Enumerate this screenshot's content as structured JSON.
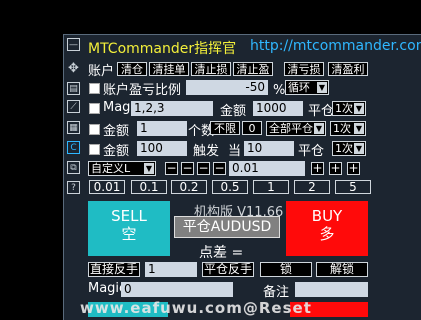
{
  "header": {
    "title": "MTCommander指挥官",
    "url": "http://mtcommander.com"
  },
  "row_account": {
    "label": "账户",
    "buttons": [
      "清仓",
      "清挂单",
      "清止损",
      "清止盈",
      "清亏损",
      "清盈利"
    ]
  },
  "row_ratio": {
    "label": "账户盈亏比例",
    "value": "-50",
    "suffix": "% 清",
    "mode": "循环"
  },
  "row_magic": {
    "label": "Magic",
    "value": "1,2,3",
    "amount_label": "金额",
    "amount": "1000",
    "action_label": "平仓",
    "count": "1次"
  },
  "row_count": {
    "label": "金额",
    "amount": "1",
    "count_label": "个数",
    "limit": "不限",
    "limit_val": "0",
    "scope": "全部平仓",
    "times": "1次"
  },
  "row_trigger": {
    "label": "金额",
    "amount": "100",
    "trigger_label": "触发",
    "when_label": "当",
    "trigger_val": "10",
    "action_label": "平仓",
    "times": "1次"
  },
  "row_custom": {
    "mode": "自定义L",
    "lot": "0.01"
  },
  "lots": [
    "0.01",
    "0.1",
    "0.2",
    "0.5",
    "1",
    "2",
    "5"
  ],
  "trade": {
    "sell": "SELL",
    "sell_cn": "空",
    "buy": "BUY",
    "buy_cn": "多",
    "version": "机构版 V11.66",
    "close_all": "平仓AUDUSD",
    "spread": "点差 ="
  },
  "row_reverse": {
    "direct_label": "直接反手",
    "direct_val": "1",
    "stop_label": "平仓反手",
    "lock": "锁",
    "unlock": "解锁"
  },
  "row_magic2": {
    "label": "Magic",
    "value": "0",
    "note_label": "备注"
  },
  "watermark": "www.eafuwu.com@Reset"
}
